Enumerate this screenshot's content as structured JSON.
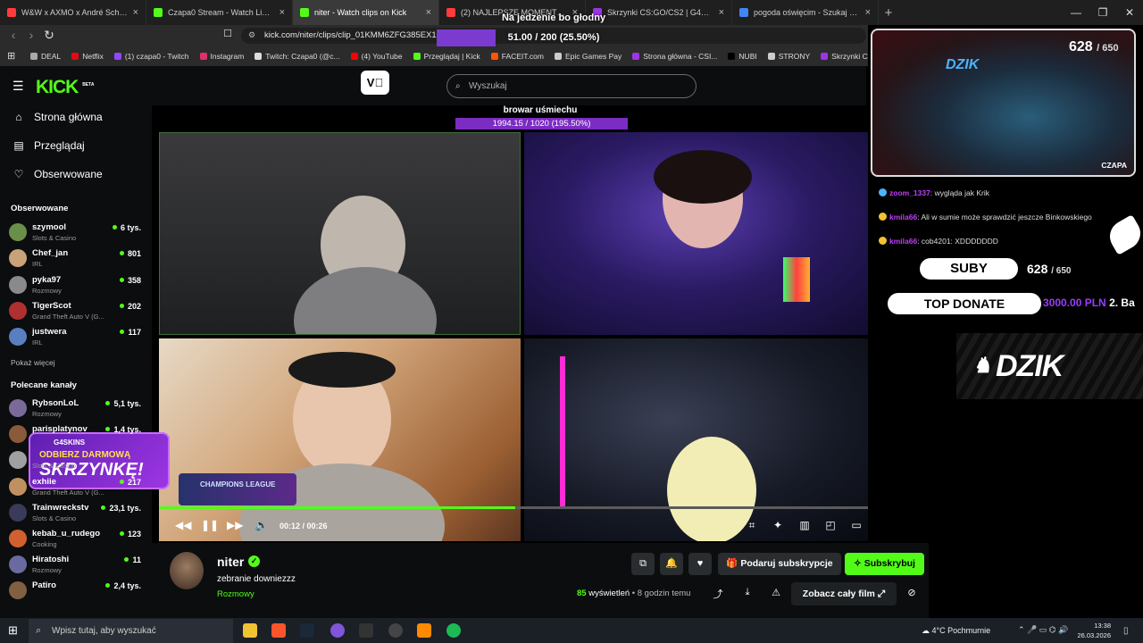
{
  "tabs": [
    {
      "title": "W&W x AXMO x André Schnura",
      "color": "#ff3b3b"
    },
    {
      "title": "Czapa0 Stream - Watch Live on Kick",
      "color": "#53fc18"
    },
    {
      "title": "niter - Watch clips on Kick",
      "color": "#53fc18",
      "active": true
    },
    {
      "title": "(2) NAJLEPSZE MOMENTY POLSKIEG...",
      "color": "#ff3b3b"
    },
    {
      "title": "Skrzynki CS:GO/CS2 | G4Skins Case o...",
      "color": "#9d35e4"
    },
    {
      "title": "pogoda oświęcim - Szukaj w Google",
      "color": "#4285f4"
    }
  ],
  "url": "kick.com/niter/clips/clip_01KMM6ZFG385EX10",
  "bookmarks": [
    {
      "label": "DEAL",
      "color": "#aaaaaa"
    },
    {
      "label": "Netflix",
      "color": "#e50914"
    },
    {
      "label": "(1) czapa0 - Twitch",
      "color": "#9146ff"
    },
    {
      "label": "Instagram",
      "color": "#e1306c"
    },
    {
      "label": "Twitch: Czapa0 (@c...",
      "color": "#dddddd"
    },
    {
      "label": "(4) YouTube",
      "color": "#ff0000"
    },
    {
      "label": "Przeglądaj | Kick",
      "color": "#53fc18"
    },
    {
      "label": "FACEIT.com",
      "color": "#ff5500"
    },
    {
      "label": "Epic Games Pay",
      "color": "#cccccc"
    },
    {
      "label": "Strona główna - CSI...",
      "color": "#9d35e4"
    },
    {
      "label": "NUBI",
      "color": "#000000"
    },
    {
      "label": "STRONY",
      "color": "#cccccc"
    },
    {
      "label": "Skrzynki CS:GO/CS...",
      "color": "#9d35e4"
    }
  ],
  "goal": {
    "title": "Na jedzenie bo głodny",
    "value": "51.00 / 200 (25.50%)"
  },
  "kick": {
    "logo": "KICK",
    "beta": "BETA",
    "search_placeholder": "Wyszukaj",
    "nav": [
      {
        "label": "Strona główna",
        "icon": "home-icon"
      },
      {
        "label": "Przeglądaj",
        "icon": "browse-icon"
      },
      {
        "label": "Obserwowane",
        "icon": "heart-icon"
      }
    ],
    "followed_title": "Obserwowane",
    "followed": [
      {
        "name": "szymool",
        "cat": "Slots & Casino",
        "viewers": "6 tys.",
        "color": "#6a8f4a"
      },
      {
        "name": "Chef_jan",
        "cat": "IRL",
        "viewers": "801",
        "color": "#c9a27a"
      },
      {
        "name": "pyka97",
        "cat": "Rozmowy",
        "viewers": "358",
        "color": "#8a8a8a"
      },
      {
        "name": "TigerScot",
        "cat": "Grand Theft Auto V (G...",
        "viewers": "202",
        "color": "#b03030"
      },
      {
        "name": "justwera",
        "cat": "IRL",
        "viewers": "117",
        "color": "#5a7fc0"
      }
    ],
    "show_more": "Pokaż więcej",
    "recommended_title": "Polecane kanały",
    "recommended": [
      {
        "name": "RybsonLoL",
        "cat": "Rozmowy",
        "viewers": "5,1 tys.",
        "color": "#7a6a9a"
      },
      {
        "name": "parisplatynov",
        "cat": "",
        "viewers": "1,4 tys.",
        "color": "#8a5a3a"
      },
      {
        "name": "",
        "cat": "Slots & Casino",
        "viewers": "",
        "color": "#a0a0a0"
      },
      {
        "name": "exhiie",
        "cat": "Grand Theft Auto V (G...",
        "viewers": "217",
        "color": "#c09060"
      },
      {
        "name": "Trainwreckstv",
        "cat": "Slots & Casino",
        "viewers": "23,1 tys.",
        "color": "#3a3a5a"
      },
      {
        "name": "kebab_u_rudego",
        "cat": "Cooking",
        "viewers": "123",
        "color": "#d06030"
      },
      {
        "name": "Hiratoshi",
        "cat": "Rozmowy",
        "viewers": "11",
        "color": "#6a6aa0"
      },
      {
        "name": "Patiro",
        "cat": "",
        "viewers": "2,4 tys.",
        "color": "#806040"
      }
    ]
  },
  "overlay": {
    "name": "browar uśmiechu",
    "bar": "1994.15 / 1020 (195.50%)"
  },
  "player": {
    "time": "00:12 / 00:26",
    "progress": 0.46
  },
  "promo": {
    "brand": "G4SKINS",
    "line1": "ODBIERZ DARMOWĄ",
    "line2": "SKRZYNKĘ!"
  },
  "champ": "CHAMPIONS LEAGUE",
  "stream": {
    "cam_label": "CZAPA",
    "logo": "DZIK",
    "subs_count": "628",
    "subs_goal": "/ 650",
    "chat": [
      {
        "user": "zoom_1337",
        "msg": ": wygląda jak Krik"
      },
      {
        "user": "kmila66",
        "msg": ": Ali w sumie może sprawdzić jeszcze Binkowskiego"
      },
      {
        "user": "kmila66",
        "msg": ": cob4201: XDDDDDDD"
      }
    ],
    "suby_label": "SUBY",
    "topdonate_label": "TOP DONATE",
    "topdonate_value": "3000.00 PLN",
    "topdonate_name": "2. Ba",
    "banner": "DZIK"
  },
  "clip": {
    "streamer": "niter",
    "title": "zebranie downiezzz",
    "category": "Rozmowy",
    "views_count": "85",
    "views_label": "wyświetleń",
    "time_ago": "• 8 godzin temu",
    "gift_label": "Podaruj subskrypcje",
    "sub_label": "Subskrybuj",
    "fullfilm_label": "Zobacz cały film"
  },
  "taskbar": {
    "search_placeholder": "Wpisz tutaj, aby wyszukać",
    "weather": "4°C  Pochmurnie",
    "time": "13:38",
    "date": "26.03.2026"
  }
}
